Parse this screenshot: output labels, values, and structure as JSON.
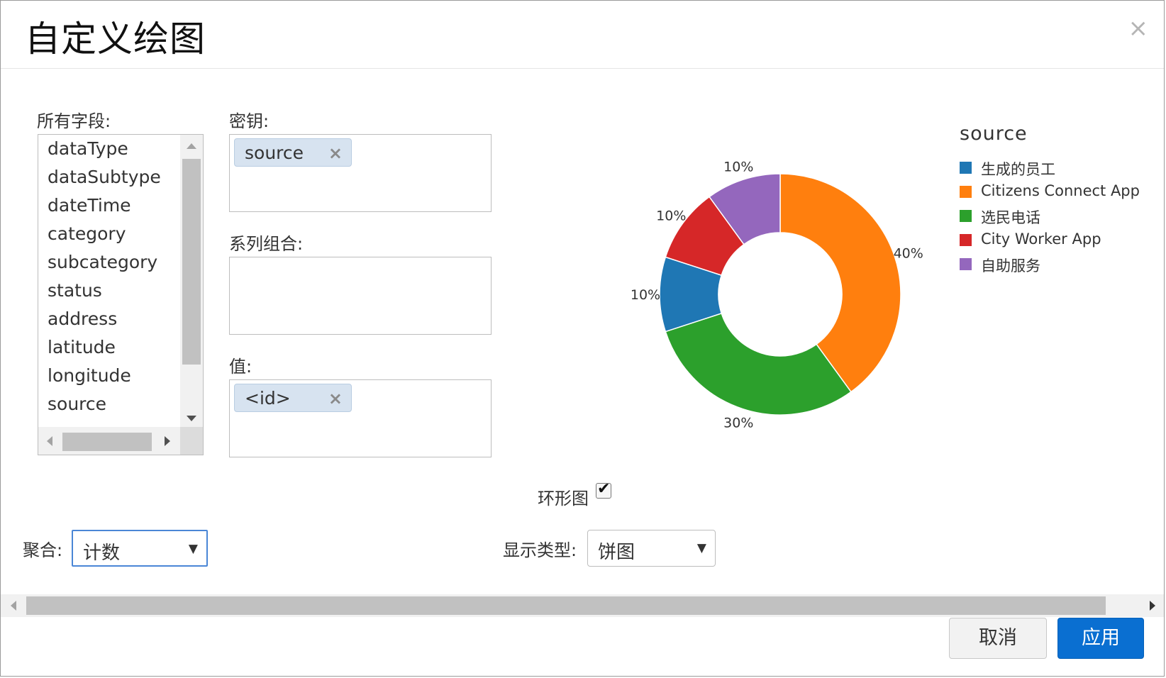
{
  "dialog": {
    "title": "自定义绘图",
    "close_glyph": "×"
  },
  "fields_panel": {
    "label": "所有字段:",
    "items": [
      "dataType",
      "dataSubtype",
      "dateTime",
      "category",
      "subcategory",
      "status",
      "address",
      "latitude",
      "longitude",
      "source"
    ]
  },
  "keys_panel": {
    "label": "密钥:",
    "chips": [
      {
        "text": "source",
        "remove": "×"
      }
    ]
  },
  "series_panel": {
    "label": "系列组合:"
  },
  "values_panel": {
    "label": "值:",
    "chips": [
      {
        "text": "<id>",
        "remove": "×"
      }
    ]
  },
  "donut_option": {
    "label": "环形图",
    "checked": true,
    "check_glyph": "✔"
  },
  "aggregation": {
    "label": "聚合:",
    "selected": "计数",
    "arrow": "▼"
  },
  "display_type": {
    "label": "显示类型:",
    "selected": "饼图",
    "arrow": "▼"
  },
  "buttons": {
    "cancel": "取消",
    "apply": "应用"
  },
  "chart_data": {
    "type": "pie",
    "donut": true,
    "legend_title": "source",
    "legend_position": "right",
    "categories": [
      "生成的员工",
      "Citizens Connect App",
      "选民电话",
      "City Worker App",
      "自助服务"
    ],
    "values": [
      10,
      40,
      30,
      10,
      10
    ],
    "labels": [
      "10%",
      "40%",
      "30%",
      "10%",
      "10%"
    ],
    "colors": [
      "#1f77b4",
      "#ff7f0e",
      "#2ca02c",
      "#d62728",
      "#9467bd"
    ]
  }
}
